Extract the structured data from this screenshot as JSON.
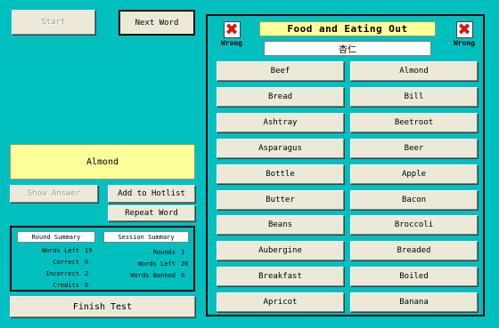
{
  "controls": {
    "start_label": "Start",
    "next_word_label": "Next Word",
    "show_answer_label": "Show Answer",
    "add_hotlist_label": "Add to  Hotlist",
    "repeat_word_label": "Repeat Word",
    "finish_test_label": "Finish Test"
  },
  "answer": "Almond",
  "summary": {
    "round_tab": "Round Summary",
    "session_tab": "Session Summary",
    "round": [
      {
        "label": "Words Left",
        "value": "19"
      },
      {
        "label": "Correct",
        "value": "0"
      },
      {
        "label": "Incorrect",
        "value": "2"
      },
      {
        "label": "Credits",
        "value": "0"
      }
    ],
    "session": [
      {
        "label": "Rounds",
        "value": "1"
      },
      {
        "label": "Words Left",
        "value": "20"
      },
      {
        "label": "Words Banked",
        "value": "0"
      }
    ]
  },
  "test": {
    "category": "Food and Eating Out",
    "prompt": "杏仁",
    "wrong_label": "Wrong",
    "wrong_icon": "red-x-icon",
    "options": [
      [
        "Beef",
        "Almond"
      ],
      [
        "Bread",
        "Bill"
      ],
      [
        "Ashtray",
        "Beetroot"
      ],
      [
        "Asparagus",
        "Beer"
      ],
      [
        "Bottle",
        "Apple"
      ],
      [
        "Butter",
        "Bacon"
      ],
      [
        "Beans",
        "Broccoli"
      ],
      [
        "Aubergine",
        "Breaded"
      ],
      [
        "Breakfast",
        "Boiled"
      ],
      [
        "Apricot",
        "Banana"
      ]
    ]
  },
  "colors": {
    "background": "#00bfbf",
    "highlight": "#ffff99",
    "wrong_x": "#e01010"
  }
}
